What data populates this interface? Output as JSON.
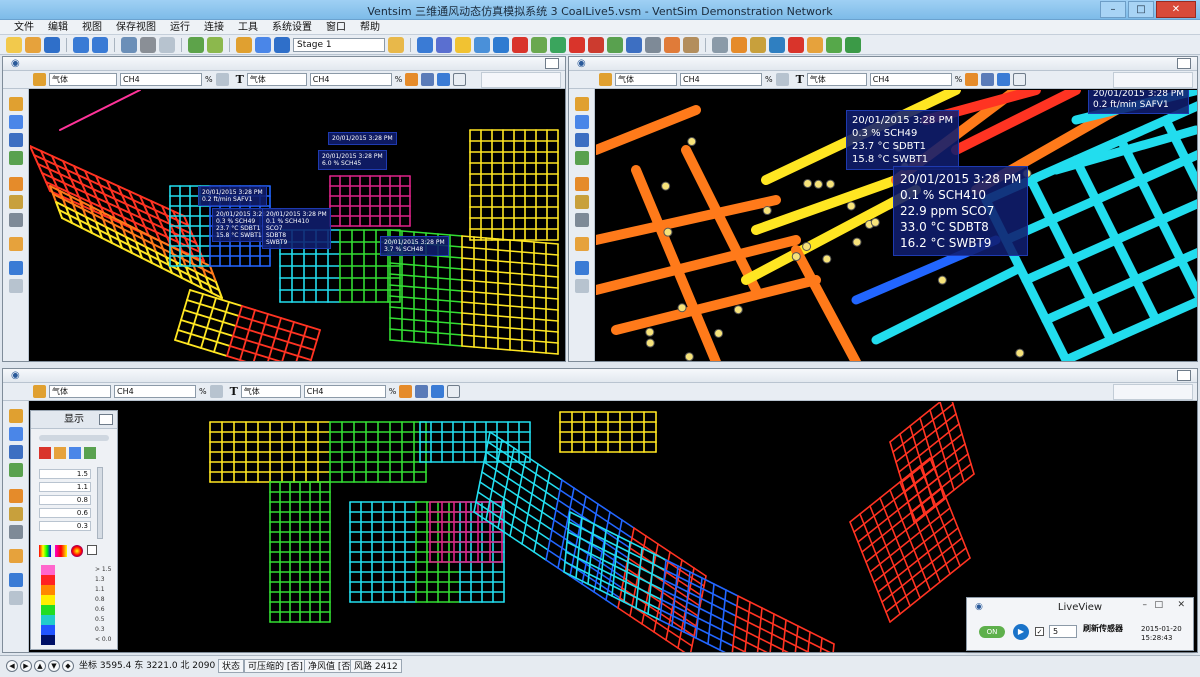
{
  "window": {
    "title": "Ventsim 三维通风动态仿真模拟系统 3    CoalLive5.vsm - VentSim Demonstration Network",
    "min": "–",
    "max": "□",
    "close": "✕"
  },
  "menu": [
    "文件",
    "编辑",
    "视图",
    "保存视图",
    "运行",
    "连接",
    "工具",
    "系统设置",
    "窗口",
    "帮助"
  ],
  "toolbar": {
    "stage_select": "Stage 1"
  },
  "panels": {
    "top_left": {
      "gas_select": "气体",
      "sub_select": "CH4",
      "pct": "%",
      "text_gas_select": "气体",
      "text_sub_select": "CH4",
      "text_pct": "%"
    },
    "top_right": {
      "gas_select": "气体",
      "sub_select": "CH4",
      "pct": "%",
      "text_gas_select": "气体",
      "text_sub_select": "CH4",
      "text_pct": "%"
    },
    "bottom": {
      "gas_select": "气体",
      "sub_select": "CH4",
      "pct": "%",
      "text_gas_select": "气体",
      "text_sub_select": "CH4",
      "text_pct": "%"
    }
  },
  "sensors_top_left": [
    {
      "lines": [
        "20/01/2015 3:28 PM",
        "0.2  ft/min SAFV1"
      ]
    },
    {
      "lines": [
        "20/01/2015 3:28 PM",
        "0.3  % SCH49",
        "23.7 °C SDBT1",
        "15.8 °C SWBT1"
      ]
    },
    {
      "lines": [
        "20/01/2015 3:28 PM",
        "0.1  % SCH410",
        "SCO7",
        "SDBT8",
        "SWBT9"
      ]
    },
    {
      "lines": [
        "20/01/2015 3:28 PM",
        "6.0  % SCH45"
      ]
    },
    {
      "lines": [
        "20/01/2015 3:28 PM",
        "3.7  % SCH48"
      ]
    },
    {
      "lines": [
        "20/01/2015 3:28 PM",
        "",
        ""
      ]
    }
  ],
  "sensors_top_right": [
    {
      "lines": [
        "20/01/2015 3:28 PM",
        "0.3  % SCH49",
        "23.7 °C SDBT1",
        "15.8 °C SWBT1"
      ]
    },
    {
      "lines": [
        "20/01/2015 3:28 PM",
        "0.1  % SCH410",
        "22.9 ppm SCO7",
        "33.0 °C SDBT8",
        "16.2 °C SWBT9"
      ]
    },
    {
      "lines": [
        "20/01/2015 3:28 PM",
        "0.2  ft/min SAFV1"
      ]
    }
  ],
  "display_panel": {
    "title": "显示",
    "values": [
      "1.5",
      "1.1",
      "0.8",
      "0.6",
      "0.3"
    ],
    "legend": [
      "> 1.5",
      "1.3",
      "1.1",
      "0.8",
      "0.6",
      "0.5",
      "0.3",
      "< 0.0"
    ],
    "legend_colors": [
      "#ff66cc",
      "#ff2222",
      "#ff8800",
      "#ffee00",
      "#22dd22",
      "#22cccc",
      "#2255ff",
      "#001066"
    ]
  },
  "liveview": {
    "title": "LiveView",
    "on": "ON",
    "play": "▶",
    "check": "✓",
    "interval": "5",
    "label": "刷新传感器",
    "date": "2015-01-20",
    "time": "15:28:43",
    "min": "–",
    "max": "□",
    "close": "✕"
  },
  "status": {
    "nav": [
      "◀",
      "▶",
      "▲",
      "▼",
      "◆"
    ],
    "coords": "坐标 3595.4 东   3221.0 北   2090 高程",
    "state_label": "状态",
    "compressible": "可压缩的 [否]",
    "net_value": "净风值 [否]",
    "airways": "风路 2412"
  }
}
